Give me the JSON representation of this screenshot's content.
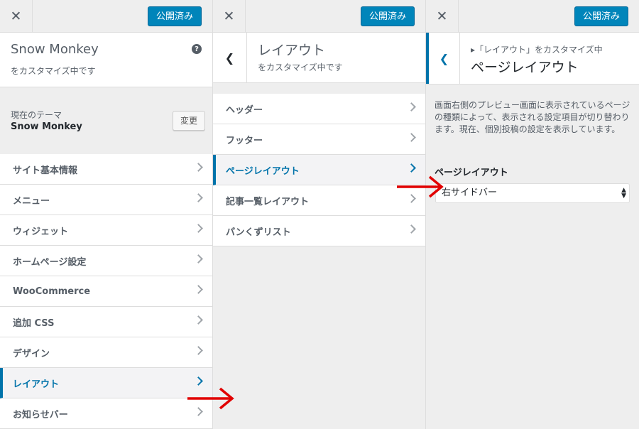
{
  "publish_label": "公開済み",
  "panel1": {
    "site_title": "Snow Monkey",
    "subtitle": "をカスタマイズ中です",
    "theme_label": "現在のテーマ",
    "theme_name": "Snow Monkey",
    "change_label": "変更",
    "items": [
      {
        "label": "サイト基本情報",
        "active": false
      },
      {
        "label": "メニュー",
        "active": false
      },
      {
        "label": "ウィジェット",
        "active": false
      },
      {
        "label": "ホームページ設定",
        "active": false
      },
      {
        "label": "WooCommerce",
        "active": false
      },
      {
        "label": "追加 CSS",
        "active": false
      },
      {
        "label": "デザイン",
        "active": false
      },
      {
        "label": "レイアウト",
        "active": true
      },
      {
        "label": "お知らせバー",
        "active": false
      }
    ]
  },
  "panel2": {
    "title": "レイアウト",
    "subtitle": "をカスタマイズ中です",
    "items": [
      {
        "label": "ヘッダー",
        "active": false
      },
      {
        "label": "フッター",
        "active": false
      },
      {
        "label": "ページレイアウト",
        "active": true
      },
      {
        "label": "記事一覧レイアウト",
        "active": false
      },
      {
        "label": "パンくずリスト",
        "active": false
      }
    ]
  },
  "panel3": {
    "breadcrumb": "▸「レイアウト」をカスタマイズ中",
    "title": "ページレイアウト",
    "description": "画面右側のプレビュー画面に表示されているページの種類によって、表示される設定項目が切り替わります。現在、個別投稿の設定を表示しています。",
    "field_label": "ページレイアウト",
    "select_value": "右サイドバー"
  },
  "colors": {
    "accent": "#0073aa",
    "publish": "#0085ba",
    "annotation_arrow": "#e10000"
  }
}
